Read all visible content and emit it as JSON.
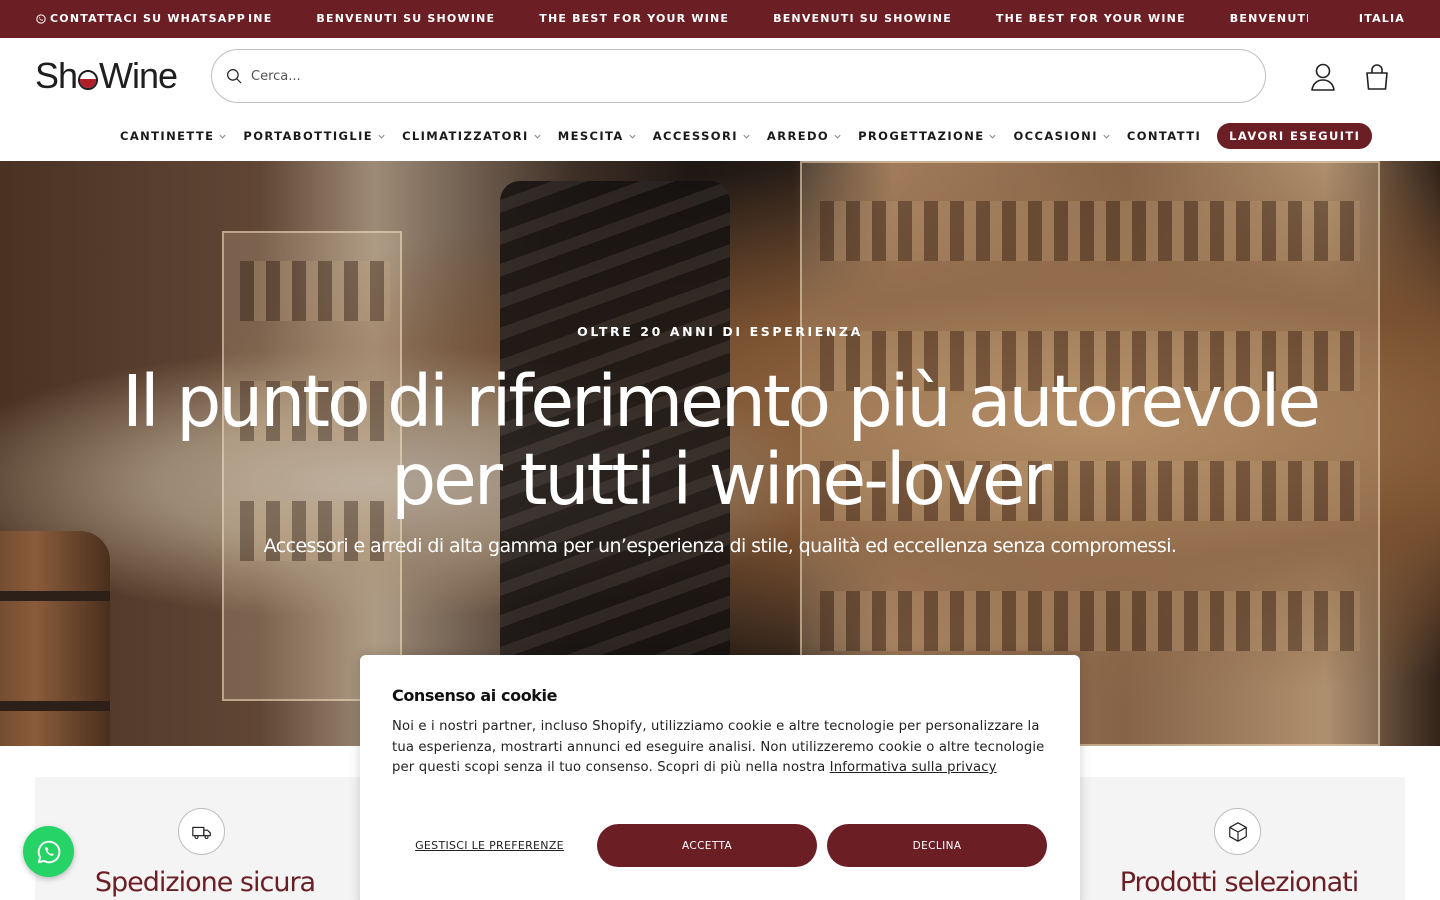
{
  "topbar": {
    "whatsapp_label": "CONTATTACI SU WHATSAPP",
    "marquee": [
      "INE",
      "BENVENUTI SU SHOWINE",
      "THE BEST FOR YOUR WINE",
      "BENVENUTI SU SHOWINE",
      "THE BEST FOR YOUR WINE",
      "BENVENUTI SU SHOWINE",
      "T"
    ],
    "country": "ITALIA",
    "bg_color": "#6b1f25"
  },
  "header": {
    "logo_text_left": "Sh",
    "logo_text_right": "Wine",
    "search_placeholder": "Cerca...",
    "account_icon": "user-icon",
    "cart_icon": "bag-icon"
  },
  "nav": {
    "items": [
      {
        "label": "CANTINETTE",
        "dropdown": true
      },
      {
        "label": "PORTABOTTIGLIE",
        "dropdown": true
      },
      {
        "label": "CLIMATIZZATORI",
        "dropdown": true
      },
      {
        "label": "MESCITA",
        "dropdown": true
      },
      {
        "label": "ACCESSORI",
        "dropdown": true
      },
      {
        "label": "ARREDO",
        "dropdown": true
      },
      {
        "label": "PROGETTAZIONE",
        "dropdown": true
      },
      {
        "label": "OCCASIONI",
        "dropdown": true
      },
      {
        "label": "CONTATTI",
        "dropdown": false
      }
    ],
    "highlight": "LAVORI ESEGUITI"
  },
  "hero": {
    "eyebrow": "OLTRE 20 ANNI DI ESPERIENZA",
    "title_line1": "Il punto di riferimento più autorevole",
    "title_line2": "per tutti i wine-lover",
    "subtitle": "Accessori e arredi di alta gamma per un’esperienza di stile, qualità ed eccellenza senza compromessi."
  },
  "features": [
    {
      "title": "Spedizione sicura",
      "icon": "truck-icon"
    },
    {
      "title": "Prodotti selezionati",
      "icon": "box-icon"
    }
  ],
  "cookie": {
    "title": "Consenso ai cookie",
    "text": "Noi e i nostri partner, incluso Shopify, utilizziamo cookie e altre tecnologie per personalizzare la tua esperienza, mostrarti annunci ed eseguire analisi. Non utilizzeremo cookie o altre tecnologie per questi scopi senza il tuo consenso. Scopri di più nella nostra ",
    "link": "Informativa sulla privacy",
    "preferences": "GESTISCI LE PREFERENZE",
    "accept": "ACCETTA",
    "decline": "DECLINA"
  },
  "colors": {
    "accent": "#6b1f25",
    "whatsapp": "#25d366"
  }
}
